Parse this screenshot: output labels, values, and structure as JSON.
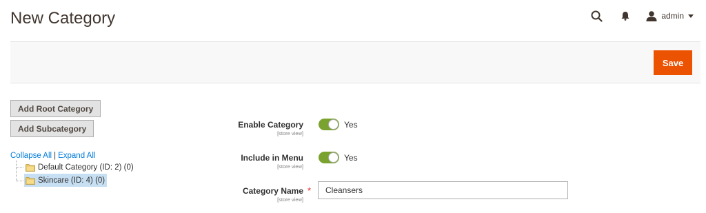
{
  "header": {
    "title": "New Category",
    "user_name": "admin",
    "icons": [
      "search-icon",
      "bell-icon",
      "user-icon",
      "chevron-down-icon"
    ]
  },
  "actions": {
    "save_label": "Save",
    "save_color": "#eb5202"
  },
  "tree": {
    "add_root_label": "Add Root Category",
    "add_sub_label": "Add Subcategory",
    "collapse_all": "Collapse All",
    "separator": "|",
    "expand_all": "Expand All",
    "nodes": [
      {
        "label": "Default Category (ID: 2) (0)",
        "selected": false,
        "icon": "folder-icon"
      },
      {
        "label": "Skincare (ID: 4) (0)",
        "selected": true,
        "icon": "folder-icon"
      }
    ],
    "selected_color": "#c7dff2"
  },
  "form": {
    "enable_category": {
      "label": "Enable Category",
      "scope": "[store view]",
      "value": "Yes",
      "on": true
    },
    "include_in_menu": {
      "label": "Include in Menu",
      "scope": "[store view]",
      "value": "Yes",
      "on": true
    },
    "category_name": {
      "label": "Category Name",
      "scope": "[store view]",
      "value": "Cleansers",
      "required": true,
      "required_mark": "*"
    },
    "toggle_on_color": "#79a22e"
  }
}
